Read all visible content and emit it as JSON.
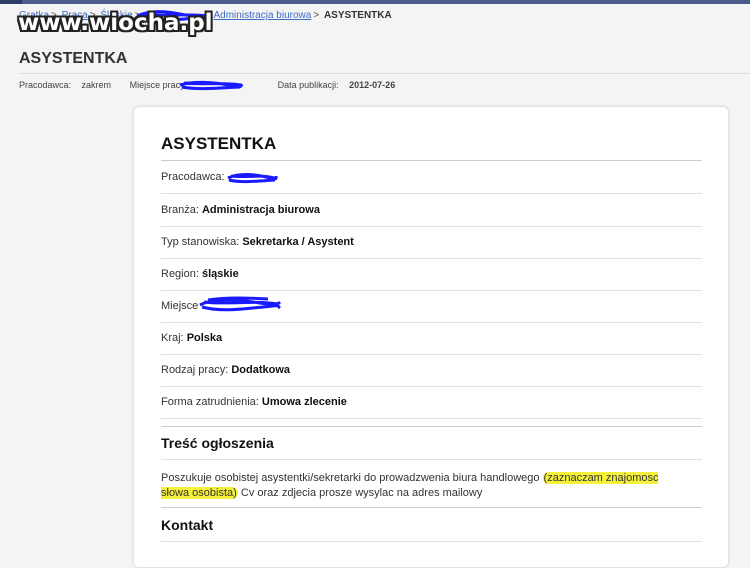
{
  "breadcrumb": {
    "items": [
      "Gratka",
      "Praca",
      "Śląskie",
      "Administracja biurowa"
    ],
    "separator": ">",
    "current": "ASYSTENTKA"
  },
  "watermark": "www.wiocha.pl",
  "page": {
    "title": "ASYSTENTKA",
    "employer_label": "Pracodawca:",
    "employer_value": "zakrem",
    "location_label": "Miejsce pracy:",
    "date_label": "Data publikacji:",
    "date_value": "2012-07-26"
  },
  "card": {
    "title": "ASYSTENTKA",
    "rows": [
      {
        "label": "Pracodawca:",
        "value": ""
      },
      {
        "label": "Branża: ",
        "value": "Administracja biurowa"
      },
      {
        "label": "Typ stanowiska: ",
        "value": "Sekretarka / Asystent"
      },
      {
        "label": "Region: ",
        "value": "śląskie"
      },
      {
        "label": "Miejsce",
        "value": ""
      },
      {
        "label": "Kraj: ",
        "value": "Polska"
      },
      {
        "label": "Rodzaj pracy: ",
        "value": "Dodatkowa"
      },
      {
        "label": "Forma zatrudnienia: ",
        "value": "Umowa zlecenie"
      }
    ],
    "description_title": "Treść ogłoszenia",
    "description_before": "Poszukuje osobistej asystentki/sekretarki do prowadzwenia biura handlowego ",
    "description_highlight": "(zaznaczam znajomosc słowa osobista)",
    "description_after": " Cv oraz zdjecia prosze wysylac na adres mailowy",
    "contact_title": "Kontakt"
  },
  "colors": {
    "link": "#3b6bc4",
    "highlight": "#f5f03a",
    "redaction": "#1a1aff"
  }
}
